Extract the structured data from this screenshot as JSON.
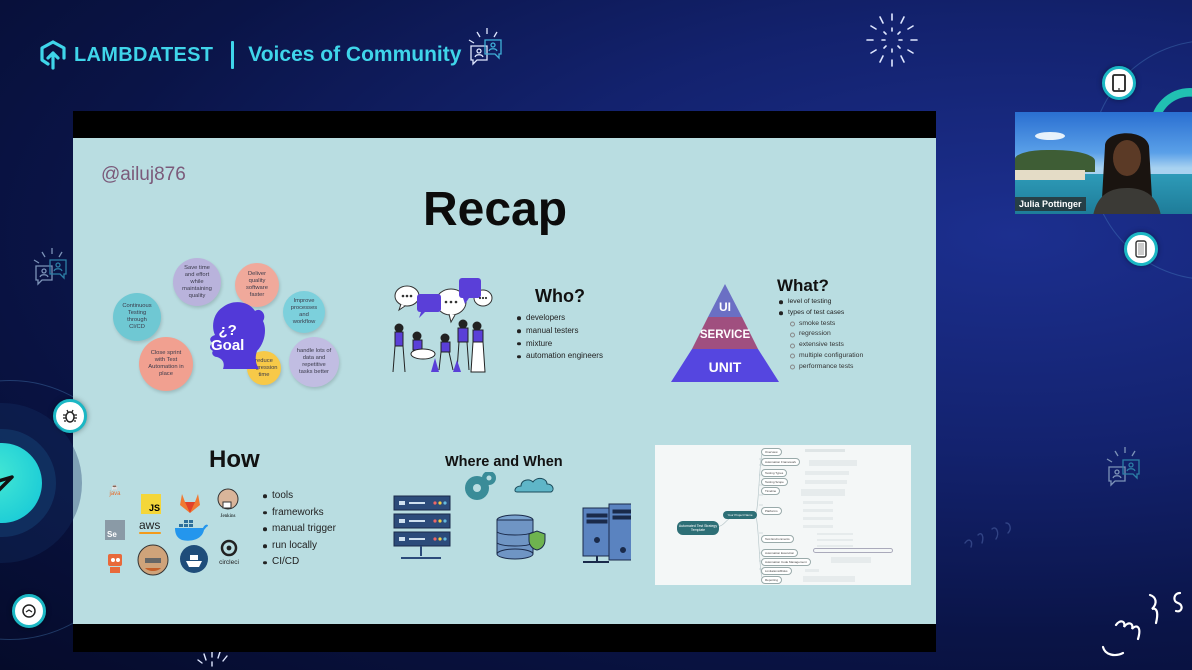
{
  "header": {
    "brand_name": "LAMBDATEST",
    "event_title": "Voices of Community",
    "accent_color": "#3fd5ea"
  },
  "slide": {
    "handle": "@ailuj876",
    "title": "Recap",
    "background_color": "#b9dde1",
    "goal": {
      "center_label_top": "¿?",
      "center_label": "Goal",
      "bubbles": [
        {
          "text": "Continuous Testing through CI/CD",
          "color": "#6fc8d3"
        },
        {
          "text": "Save time and effort while maintaining quality",
          "color": "#b9b3dc"
        },
        {
          "text": "Deliver quality software faster",
          "color": "#f0a99b"
        },
        {
          "text": "Improve processes and workflow",
          "color": "#7cd0dc"
        },
        {
          "text": "Close sprint with Test Automation in place",
          "color": "#f1a090"
        },
        {
          "text": "reduce regression time",
          "color": "#f7c948"
        },
        {
          "text": "handle lots of data and repetitive tasks better",
          "color": "#c1bde2"
        }
      ]
    },
    "who": {
      "title": "Who?",
      "items": [
        "developers",
        "manual testers",
        "mixture",
        "automation engineers"
      ]
    },
    "what": {
      "title": "What?",
      "items": [
        "level of testing",
        "types of test cases"
      ],
      "sub_items": [
        "smoke tests",
        "regression",
        "extensive tests",
        "multiple configuration",
        "performance tests"
      ],
      "pyramid": [
        {
          "label": "UI",
          "color": "#6b6fc4"
        },
        {
          "label": "SERVICE",
          "color": "#a04f7f"
        },
        {
          "label": "UNIT",
          "color": "#5546e0"
        }
      ]
    },
    "how": {
      "title": "How",
      "items": [
        "tools",
        "frameworks",
        "manual trigger",
        "run locally",
        "CI/CD"
      ],
      "logos": [
        "java",
        "JS",
        "gitlab",
        "Jenkins",
        "Se",
        "aws",
        "docker",
        "circleci",
        "robot",
        "travis",
        "ship"
      ]
    },
    "where_when": {
      "title": "Where and When"
    },
    "mindmap": {
      "root": "Automated Test Strategy Template",
      "hub": "Your Project Name",
      "branches": [
        "Overview",
        "Automation Framework",
        "Testing Types",
        "Testing Scope",
        "Timeline",
        "Platforms",
        "Test Environments",
        "Automation Execution",
        "Automation Code Management",
        "Limitations/Risks",
        "Reporting"
      ]
    }
  },
  "speaker": {
    "name": "Julia Pottinger"
  },
  "controls": {
    "tablet_icon": "tablet-icon",
    "phone_icon": "phone-icon",
    "bug_icon": "bug-icon",
    "clock_icon": "clock-icon"
  }
}
